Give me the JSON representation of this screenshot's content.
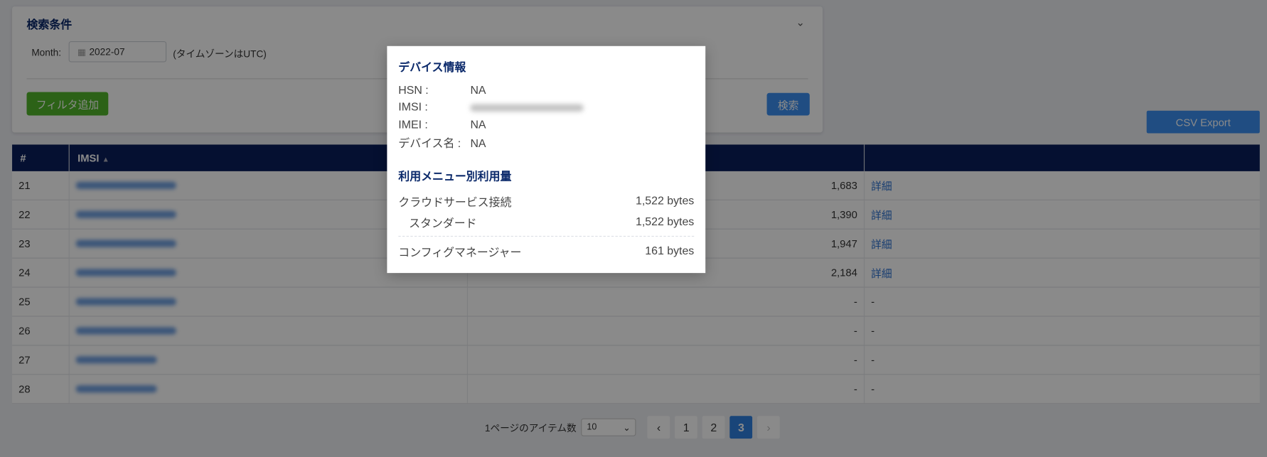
{
  "search": {
    "title": "検索条件",
    "month_label": "Month:",
    "month_value": "2022-07",
    "timezone_note": "(タイムゾーンはUTC)",
    "add_filter_label": "フィルタ追加",
    "search_label": "検索"
  },
  "csv_export_label": "CSV Export",
  "table": {
    "headers": [
      "#",
      "IMSI"
    ],
    "rows": [
      {
        "no": "21",
        "value": "1,683",
        "action": "詳細"
      },
      {
        "no": "22",
        "value": "1,390",
        "action": "詳細"
      },
      {
        "no": "23",
        "value": "1,947",
        "action": "詳細"
      },
      {
        "no": "24",
        "value": "2,184",
        "action": "詳細"
      },
      {
        "no": "25",
        "value": "-",
        "action": "-"
      },
      {
        "no": "26",
        "value": "-",
        "action": "-"
      },
      {
        "no": "27",
        "value": "-",
        "action": "-"
      },
      {
        "no": "28",
        "value": "-",
        "action": "-"
      }
    ]
  },
  "pagination": {
    "items_per_page_label": "1ページのアイテム数",
    "items_per_page": "10",
    "pages": [
      "1",
      "2",
      "3"
    ],
    "current_page": "3"
  },
  "modal": {
    "device_title": "デバイス情報",
    "fields": [
      {
        "label": "HSN :",
        "value": "NA"
      },
      {
        "label": "IMSI :",
        "value": ""
      },
      {
        "label": "IMEI :",
        "value": "NA"
      },
      {
        "label": "デバイス名 :",
        "value": "NA"
      }
    ],
    "usage_title": "利用メニュー別利用量",
    "usage": [
      {
        "label": "クラウドサービス接続",
        "value": "1,522 bytes"
      },
      {
        "label": "スタンダード",
        "value": "1,522 bytes"
      },
      {
        "label": "コンフィグマネージャー",
        "value": "161 bytes"
      }
    ]
  }
}
